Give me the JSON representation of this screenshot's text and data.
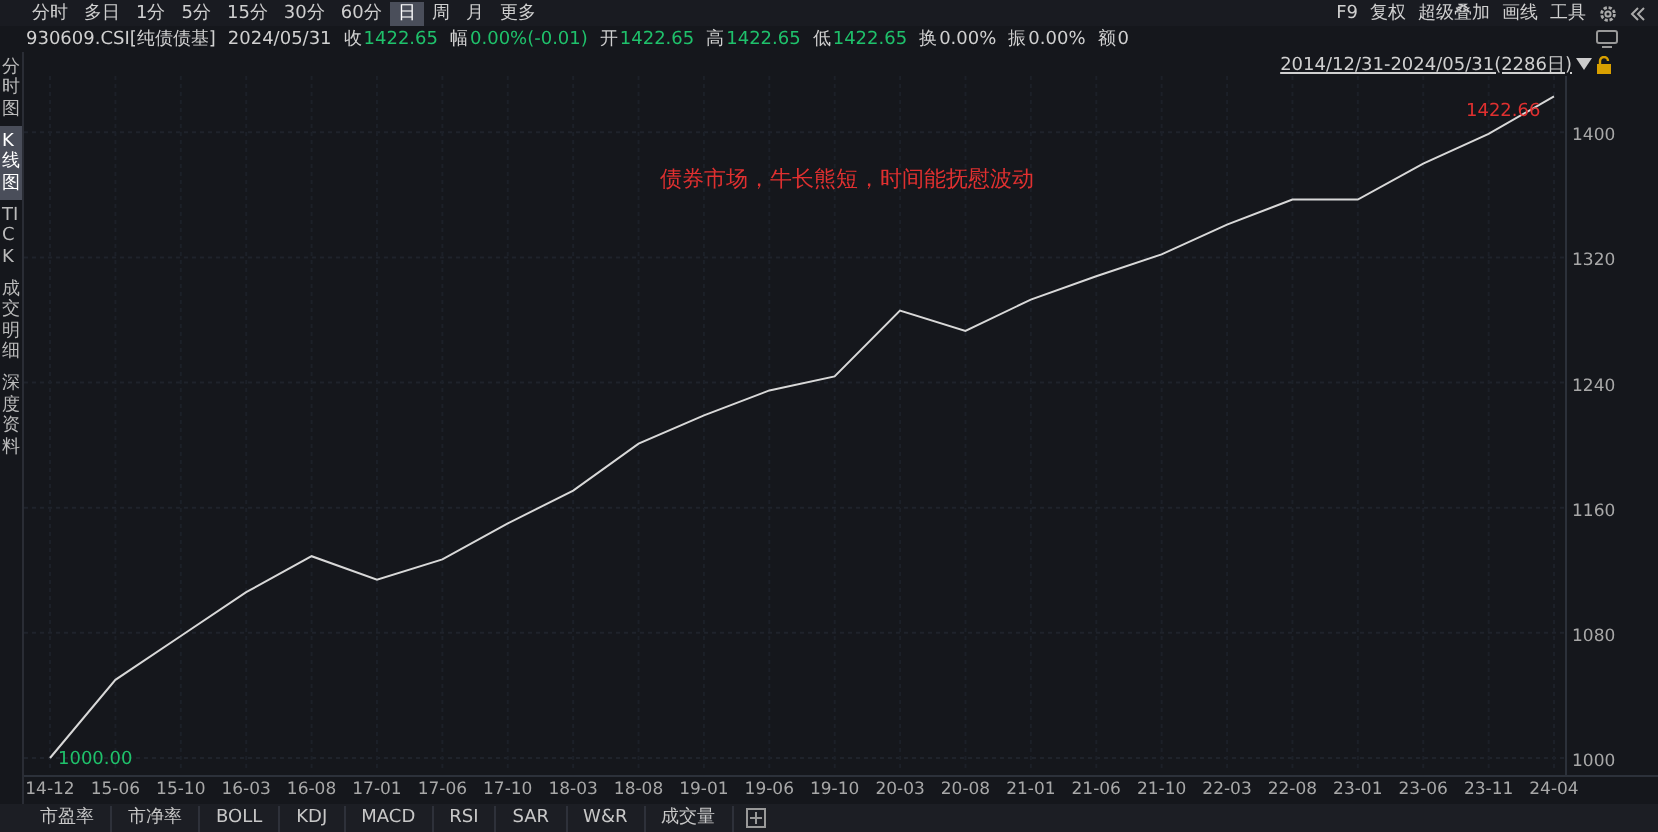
{
  "period_tabs": [
    {
      "label": "分时",
      "selected": false
    },
    {
      "label": "多日",
      "selected": false
    },
    {
      "label": "1分",
      "selected": false
    },
    {
      "label": "5分",
      "selected": false
    },
    {
      "label": "15分",
      "selected": false
    },
    {
      "label": "30分",
      "selected": false
    },
    {
      "label": "60分",
      "selected": false
    },
    {
      "label": "日",
      "selected": true
    },
    {
      "label": "周",
      "selected": false
    },
    {
      "label": "月",
      "selected": false
    },
    {
      "label": "更多",
      "selected": false
    }
  ],
  "toolbar": [
    "F9",
    "复权",
    "超级叠加",
    "画线",
    "工具"
  ],
  "quote": {
    "code": "930609.CSI[纯债债基]",
    "date": "2024/05/31",
    "fields": [
      {
        "label": "收",
        "value": "1422.65",
        "kind": "price"
      },
      {
        "label": "幅",
        "value": "0.00%(-0.01)",
        "kind": "price"
      },
      {
        "label": "开",
        "value": "1422.65",
        "kind": "price"
      },
      {
        "label": "高",
        "value": "1422.65",
        "kind": "price"
      },
      {
        "label": "低",
        "value": "1422.65",
        "kind": "price"
      },
      {
        "label": "换",
        "value": "0.00%",
        "kind": "plain"
      },
      {
        "label": "振",
        "value": "0.00%",
        "kind": "plain"
      },
      {
        "label": "额",
        "value": "0",
        "kind": "plain"
      }
    ]
  },
  "sidebar": [
    {
      "label": "分时图",
      "selected": false
    },
    {
      "label": "K线图",
      "selected": true
    },
    {
      "label": "TICK",
      "selected": false
    },
    {
      "label": "成交明细",
      "selected": false
    },
    {
      "label": "深度资料",
      "selected": false
    }
  ],
  "date_range": "2014/12/31-2024/05/31(2286日)",
  "chart": {
    "annotation": "债券市场，牛长熊短，时间能抚慰波动",
    "high_label": "1422.66",
    "low_label": "1000.00",
    "chart_data": {
      "type": "line",
      "categories": [
        "14-12",
        "15-06",
        "15-10",
        "16-03",
        "16-08",
        "17-01",
        "17-06",
        "17-10",
        "18-03",
        "18-08",
        "19-01",
        "19-06",
        "19-10",
        "20-03",
        "20-08",
        "21-01",
        "21-06",
        "21-10",
        "22-03",
        "22-08",
        "23-01",
        "23-06",
        "23-11",
        "24-04"
      ],
      "series": [
        {
          "color": "#d8d8d8",
          "values": [
            1000,
            1050,
            1078,
            1106,
            1129,
            1114,
            1127,
            1150,
            1171,
            1201,
            1219,
            1235,
            1244,
            1286,
            1273,
            1293,
            1308,
            1322,
            1341,
            1357,
            1357,
            1380,
            1399,
            1423
          ]
        }
      ],
      "ylim": [
        1000,
        1436
      ],
      "yticks": [
        1000,
        1080,
        1160,
        1240,
        1320,
        1400
      ],
      "grid": true
    }
  },
  "indicator_tabs": [
    {
      "label": "市盈率",
      "selected": false
    },
    {
      "label": "市净率",
      "selected": false
    },
    {
      "label": "BOLL",
      "selected": false
    },
    {
      "label": "KDJ",
      "selected": false
    },
    {
      "label": "MACD",
      "selected": false
    },
    {
      "label": "RSI",
      "selected": false
    },
    {
      "label": "SAR",
      "selected": false
    },
    {
      "label": "W&R",
      "selected": false
    },
    {
      "label": "成交量",
      "selected": false
    }
  ]
}
